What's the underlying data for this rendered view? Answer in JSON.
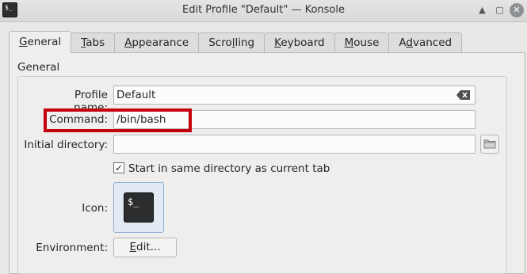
{
  "window": {
    "title": "Edit Profile \"Default\" — Konsole",
    "icon_text": "$_",
    "buttons": [
      "up-arrow-icon",
      "maximize-icon",
      "close-icon"
    ]
  },
  "tabs": [
    {
      "label_u": "G",
      "label_rest": "eneral",
      "active": true
    },
    {
      "label_u": "T",
      "label_rest": "abs"
    },
    {
      "label_u": "A",
      "label_rest": "ppearance"
    },
    {
      "label_pre": "Scro",
      "label_u": "l",
      "label_rest": "ling"
    },
    {
      "label_u": "K",
      "label_rest": "eyboard"
    },
    {
      "label_u": "M",
      "label_rest": "ouse"
    },
    {
      "label_pre": "A",
      "label_u": "d",
      "label_rest": "vanced"
    }
  ],
  "general": {
    "group_title": "General",
    "profile_name": {
      "label": "Profile name:",
      "value": "Default"
    },
    "command": {
      "label": "Command:",
      "value": "/bin/bash"
    },
    "initial_directory": {
      "label": "Initial directory:",
      "value": ""
    },
    "start_same_dir": {
      "label": "Start in same directory as current tab",
      "checked": true,
      "check_glyph": "✓"
    },
    "icon": {
      "label": "Icon:",
      "glyph": "$_"
    },
    "environment": {
      "label": "Environment:",
      "button_u": "E",
      "button_rest": "dit..."
    }
  },
  "colors": {
    "highlight": "#c4000d",
    "icon_selected_border": "#8cb1d3"
  }
}
